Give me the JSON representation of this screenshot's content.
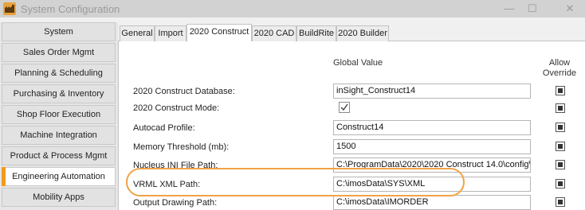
{
  "window": {
    "title": "System Configuration",
    "minimize": "—",
    "maximize": "☐",
    "close": "✕"
  },
  "sidebar": {
    "items": [
      {
        "label": "System"
      },
      {
        "label": "Sales Order Mgmt"
      },
      {
        "label": "Planning & Scheduling"
      },
      {
        "label": "Purchasing & Inventory"
      },
      {
        "label": "Shop Floor Execution"
      },
      {
        "label": "Machine Integration"
      },
      {
        "label": "Product & Process Mgmt"
      },
      {
        "label": "Engineering Automation",
        "active": true
      },
      {
        "label": "Mobility Apps"
      }
    ],
    "accent_color": "#f29a1f"
  },
  "tabs": [
    {
      "label": "General"
    },
    {
      "label": "Import"
    },
    {
      "label": "2020 Construct",
      "active": true
    },
    {
      "label": "2020 CAD"
    },
    {
      "label": "BuildRite"
    },
    {
      "label": "2020 Builder"
    }
  ],
  "columns": {
    "global_value": "Global Value",
    "allow_override": "Allow Override"
  },
  "rows": [
    {
      "label": "2020 Construct Database:",
      "value": "inSight_Construct14",
      "override": true
    },
    {
      "label": "2020 Construct Mode:",
      "checked": true,
      "override": true
    },
    {
      "label": "Autocad Profile:",
      "value": "Construct14",
      "override": true
    },
    {
      "label": "Memory Threshold (mb):",
      "value": "1500",
      "override": true
    },
    {
      "label": "Nucleus INI File Path:",
      "value": "C:\\ProgramData\\2020\\2020 Construct 14.0\\config\\",
      "override": true
    },
    {
      "label": "VRML XML Path:",
      "value": "C:\\imosData\\SYS\\XML",
      "override": true
    },
    {
      "label": "Output Drawing Path:",
      "value": "C:\\imosData\\IMORDER",
      "override": true
    }
  ],
  "highlight_color": "#f0a348"
}
